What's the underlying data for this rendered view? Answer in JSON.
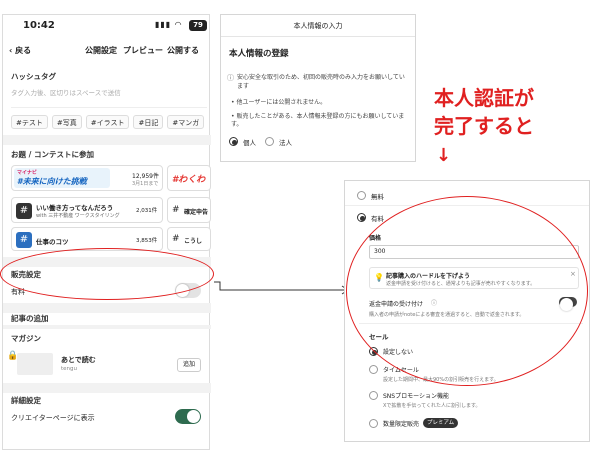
{
  "phone": {
    "status": {
      "time": "10:42",
      "battery": "79"
    },
    "nav": {
      "back": "戻る",
      "settings": "公開設定",
      "preview": "プレビュー",
      "publish": "公開する"
    },
    "hashtag": {
      "title": "ハッシュタグ",
      "placeholder": "タグ入力後、区切りはスペースで送信",
      "tags": [
        "#テスト",
        "#写真",
        "#イラスト",
        "#日記",
        "#マンガ"
      ]
    },
    "contest": {
      "title": "お題 / コンテストに参加",
      "banner_logo": "マイナビ",
      "banner_text": "#未来に向けた挑戦",
      "banner_count": "12,959件",
      "banner_date": "3月1日まで",
      "banner2_text": "#わくわ",
      "item1_title": "いい働き方ってなんだろう",
      "item1_sub": "with 三井不動産 ワークスタイリング",
      "item1_count": "2,031件",
      "item2_title": "仕事のコツ",
      "item2_count": "3,853件",
      "side1": "確定申告",
      "side2": "こうし"
    },
    "sales": {
      "title": "販売設定",
      "label": "有料"
    },
    "article": {
      "title": "記事の追加"
    },
    "magazine": {
      "title": "マガジン",
      "name": "あとで読む",
      "owner": "tengu",
      "add": "追加"
    },
    "detail": {
      "title": "詳細設定",
      "creator_page": "クリエイターページに表示"
    }
  },
  "identity": {
    "header": "本人情報の入力",
    "title": "本人情報の登録",
    "note": "安心安全な取引のため、初回の販売時のみ入力をお願いしています",
    "bullet1": "他ユーザーには公開されません。",
    "bullet2": "販売したことがある、本人情報未登録の方にもお願いしています。",
    "option_personal": "個人",
    "option_corp": "法人"
  },
  "annotation": {
    "line1": "本人認証が",
    "line2": "完了すると",
    "arrow": "↓"
  },
  "paid": {
    "free": "無料",
    "paid": "有料",
    "price_label": "価格",
    "price_value": "300",
    "tip_title": "記事購入のハードルを下げよう",
    "tip_body": "返金申請を受け付けると、通常よりも記事が売れやすくなります。",
    "refund_label": "返金申請の受け付け",
    "refund_desc": "購入者の申請がnoteによる審査を通過すると、自動で返金されます。",
    "sale_title": "セール",
    "sale_none": "設定しない",
    "time_sale": "タイムセール",
    "time_sale_desc": "設定した期間中、最大90%の割引販売を行えます。",
    "sns_promo": "SNSプロモーション機能",
    "sns_desc": "Xで拡散を手伝ってくれた人に割引します。",
    "limited": "数量限定販売",
    "premium": "プレミアム"
  },
  "colors": {
    "accent": "#e02020",
    "toggle_on": "#2e6b4f"
  }
}
